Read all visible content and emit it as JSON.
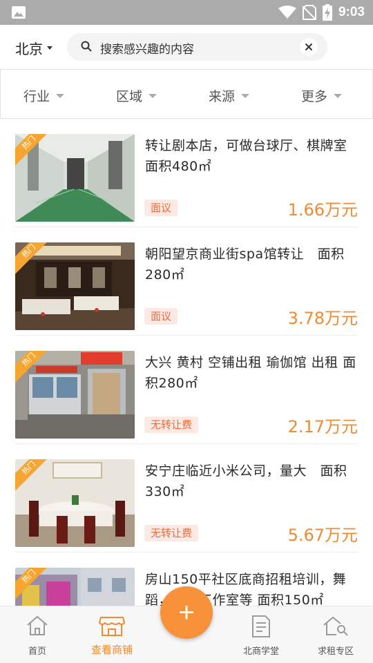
{
  "status_bar": {
    "time": "9:03",
    "icons": [
      "photo-icon",
      "wifi-icon",
      "no-sim-icon",
      "battery-charging-icon"
    ]
  },
  "header": {
    "city": "北京",
    "search_placeholder": "搜索感兴趣的内容"
  },
  "filters": [
    {
      "label": "行业"
    },
    {
      "label": "区域"
    },
    {
      "label": "来源"
    },
    {
      "label": "更多"
    }
  ],
  "hot_badge": "热门",
  "listings": [
    {
      "title": "转让剧本店，可做台球厅、棋牌室 面积480㎡",
      "tag": "面议",
      "price": "1.66万元",
      "image": "corridor-photo"
    },
    {
      "title": "朝阳望京商业街spa馆转让　面积280㎡",
      "tag": "面议",
      "price": "3.78万元",
      "image": "spa-room-photo"
    },
    {
      "title": "大兴 黄村 空铺出租 瑜伽馆 出租 面积280㎡",
      "tag": "无转让费",
      "price": "2.17万元",
      "image": "storefront-photo"
    },
    {
      "title": "安宁庄临近小米公司，量大　面积330㎡",
      "tag": "无转让费",
      "price": "5.67万元",
      "image": "dining-room-photo"
    },
    {
      "title": "房山150平社区底商招租培训，舞蹈，健身工作室等 面积150㎡",
      "tag": "",
      "price": "",
      "image": "building-photo"
    }
  ],
  "bottom_nav": [
    {
      "label": "首页",
      "icon": "home-icon",
      "active": false
    },
    {
      "label": "查看商铺",
      "icon": "shop-icon",
      "active": true
    },
    {
      "label": "北商学堂",
      "icon": "document-icon",
      "active": false
    },
    {
      "label": "求租专区",
      "icon": "house-search-icon",
      "active": false
    }
  ],
  "fab": {
    "icon": "plus-icon"
  },
  "colors": {
    "accent": "#f08a33",
    "hot_badge": "#f5a631",
    "tag_text": "#f06a3a",
    "tag_bg": "#fde9e3"
  }
}
